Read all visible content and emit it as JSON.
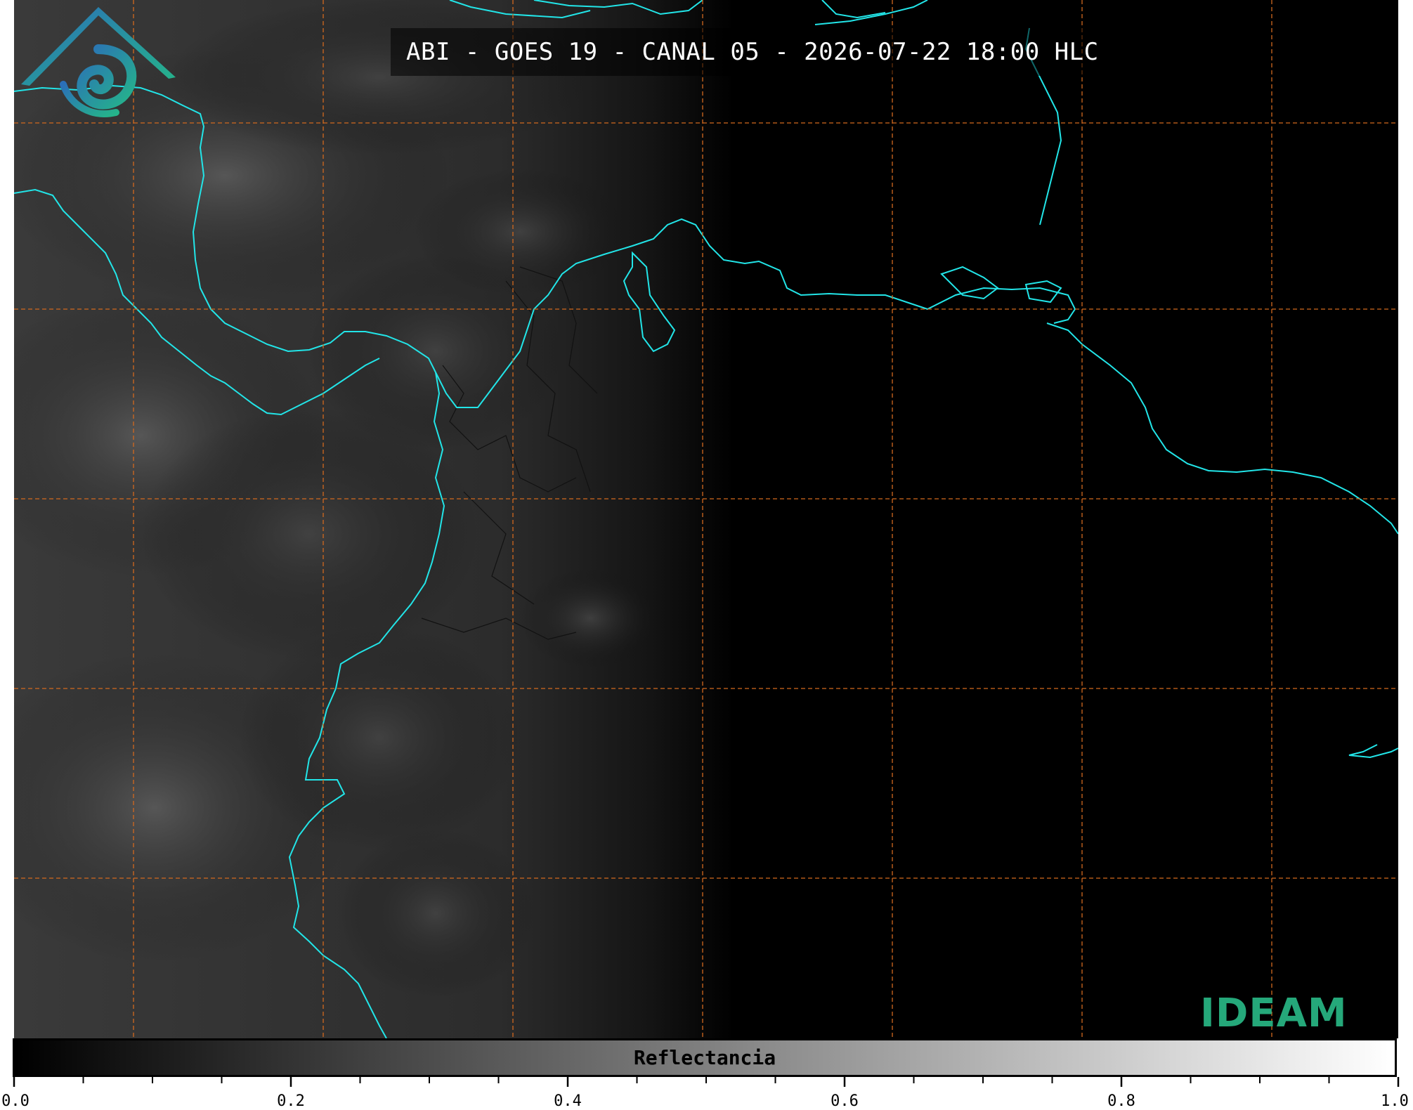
{
  "title": "ABI - GOES 19 - CANAL 05 - 2026-07-22 18:00 HLC",
  "logo": {
    "text": "IDEAM"
  },
  "colorbar": {
    "label": "Reflectancia",
    "tick_labels": [
      "0.0",
      "0.2",
      "0.4",
      "0.6",
      "0.8",
      "1.0"
    ],
    "range": [
      0.0,
      1.0
    ],
    "minor_step": 0.05,
    "gradient": [
      "#000000",
      "#ffffff"
    ]
  },
  "colors": {
    "coastline": "#22e5e8",
    "grid": "#d2691e",
    "borders": "#111111",
    "background": "#000000"
  },
  "legend_icons": [
    "ideam-logo-icon"
  ]
}
